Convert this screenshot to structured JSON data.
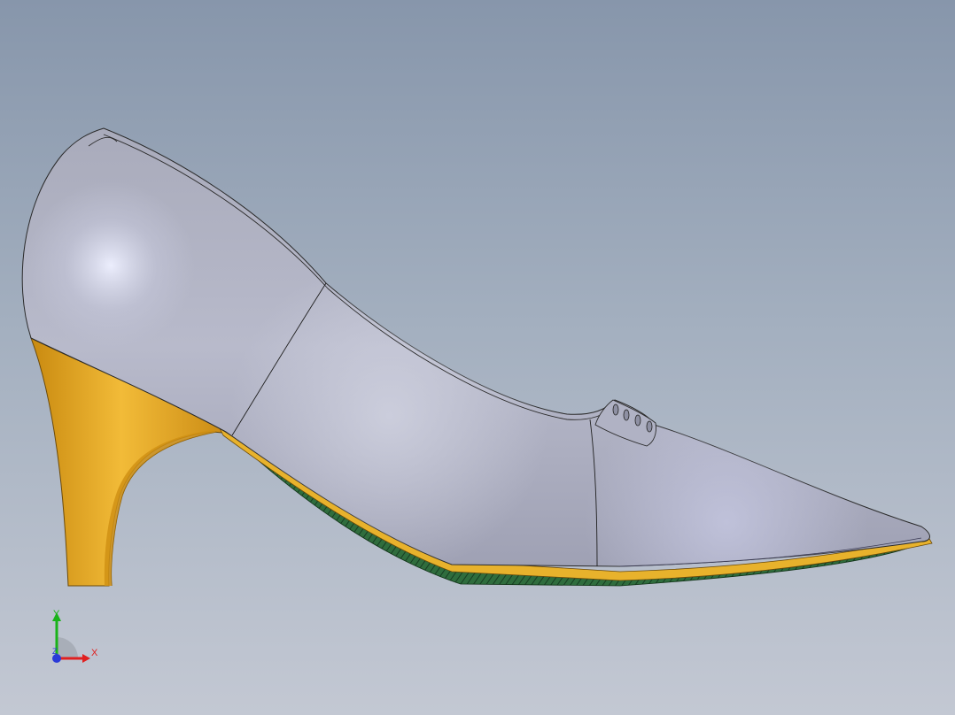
{
  "viewport": {
    "background_top": "#8796ab",
    "background_bottom": "#c3c8d3"
  },
  "model": {
    "upper_color": "#b4b6c8",
    "heel_color": "#e0a21c",
    "sole_color": "#2d6b3c",
    "edge_color": "#2a2a2a"
  },
  "triad": {
    "x_label": "X",
    "y_label": "Y",
    "z_label": "Z",
    "x_color": "#e02020",
    "y_color": "#19b319",
    "z_color": "#2a3ad8"
  }
}
